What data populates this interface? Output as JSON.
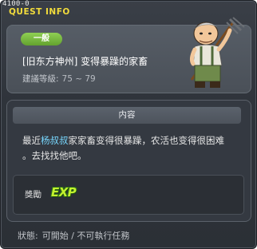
{
  "window": {
    "quest_id": "4100-0",
    "header": "QUEST INFO"
  },
  "quest": {
    "category": "一般",
    "title": "[旧东方神州] 变得暴躁的家畜",
    "level_label": "建議等級:",
    "level_range": "75 ~ 79"
  },
  "content": {
    "header": "内容",
    "desc_before": "最近",
    "desc_highlight": "杨叔叔",
    "desc_line1_after": "家家畜变得很暴躁，农活也变得很困难",
    "desc_line2": "。去找找他吧。"
  },
  "reward": {
    "label": "獎勵",
    "exp_text": "EXP"
  },
  "status": {
    "label": "狀態:",
    "value": "可開始 / 不可執行任務"
  },
  "colors": {
    "header_yellow": "#f2dc3c",
    "badge_green": "#7ab942",
    "highlight_blue": "#78d8ff",
    "exp_green": "#c3f22e"
  },
  "icons": [
    "npc-farmer-portrait",
    "exp-icon"
  ]
}
